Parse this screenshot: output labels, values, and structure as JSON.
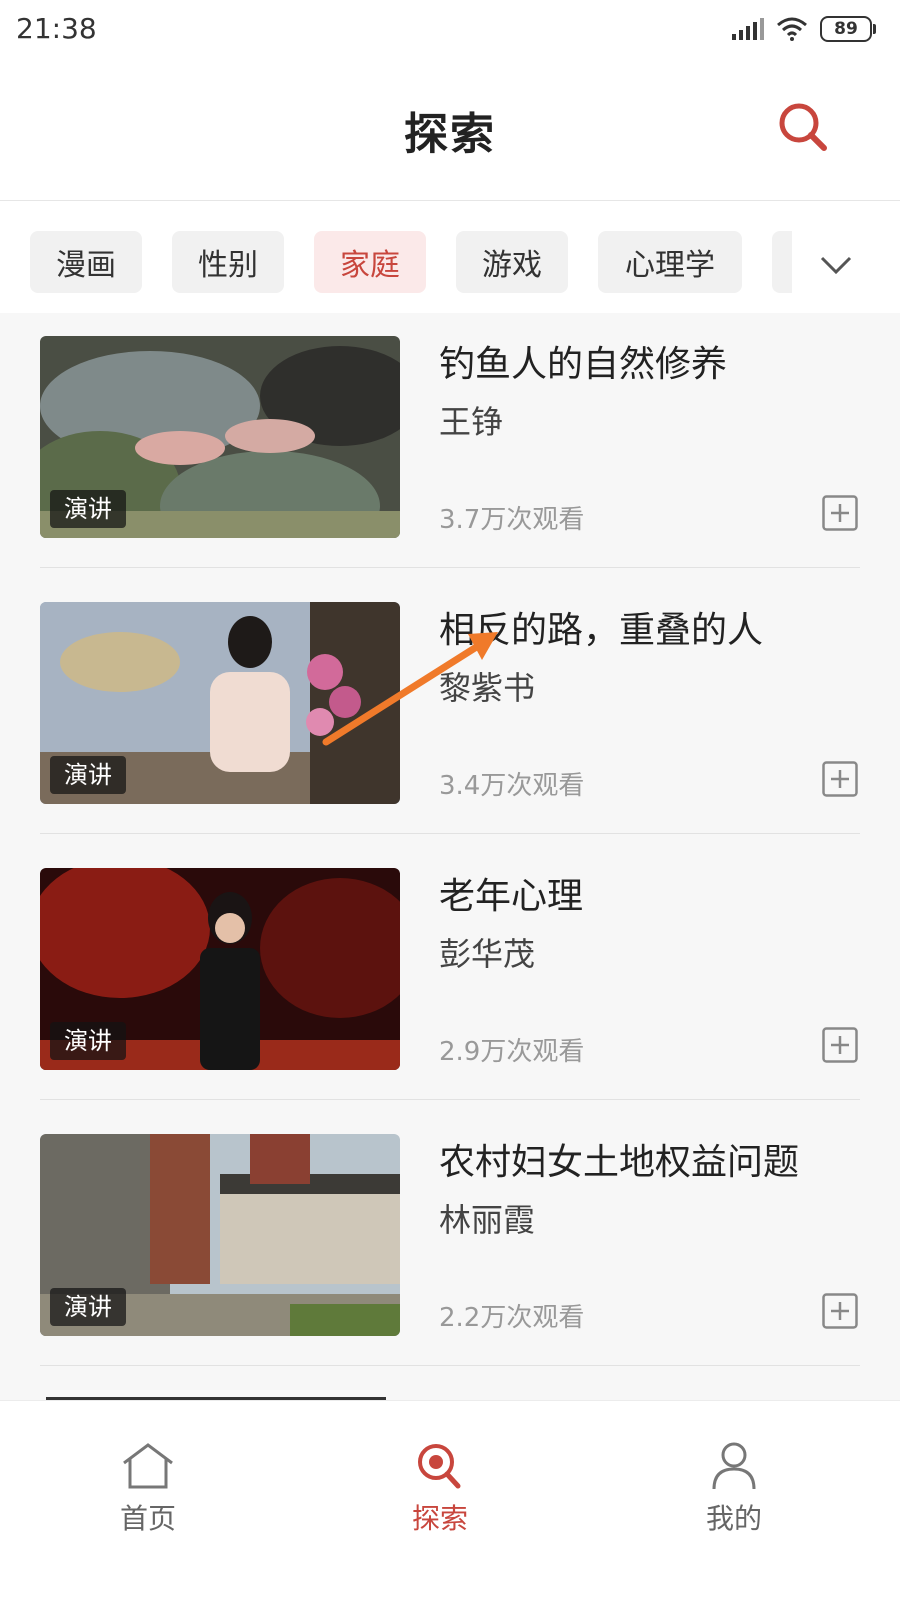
{
  "status_bar": {
    "time": "21:38",
    "battery": "89"
  },
  "header": {
    "title": "探索"
  },
  "categories": {
    "items": [
      {
        "label": "漫画",
        "active": false
      },
      {
        "label": "性别",
        "active": false
      },
      {
        "label": "家庭",
        "active": true
      },
      {
        "label": "游戏",
        "active": false
      },
      {
        "label": "心理学",
        "active": false
      }
    ]
  },
  "list": {
    "items": [
      {
        "title": "钓鱼人的自然修养",
        "speaker": "王铮",
        "views": "3.7万次观看",
        "tag": "演讲"
      },
      {
        "title": "相反的路，重叠的人",
        "speaker": "黎紫书",
        "views": "3.4万次观看",
        "tag": "演讲"
      },
      {
        "title": "老年心理",
        "speaker": "彭华茂",
        "views": "2.9万次观看",
        "tag": "演讲"
      },
      {
        "title": "农村妇女土地权益问题",
        "speaker": "林丽霞",
        "views": "2.2万次观看",
        "tag": "演讲"
      }
    ]
  },
  "bottom_nav": {
    "items": [
      {
        "label": "首页",
        "icon": "home-icon",
        "active": false
      },
      {
        "label": "探索",
        "icon": "search-icon",
        "active": true
      },
      {
        "label": "我的",
        "icon": "user-icon",
        "active": false
      }
    ]
  },
  "colors": {
    "accent": "#c8463d",
    "arrow": "#f07a2a"
  }
}
